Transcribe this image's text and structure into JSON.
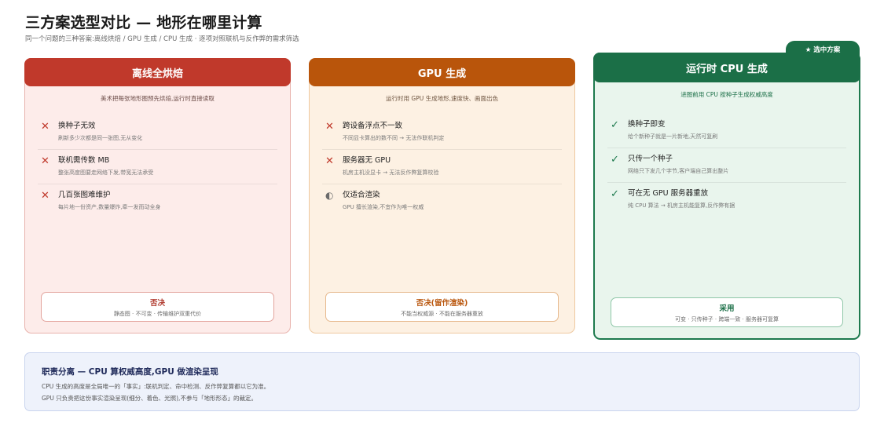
{
  "header": {
    "title": "三方案选型对比 — 地形在哪里计算",
    "subtitle": "同一个问题的三种答案:离线烘焙 / GPU 生成 / CPU 生成 · 逐项对照联机与反作弊的需求筛选"
  },
  "badge": "★ 选中方案",
  "cards": [
    {
      "title": "离线全烘焙",
      "desc": "美术把每张地形图预先烘焙,运行时直接读取",
      "items": [
        {
          "icon": "cross-icon",
          "glyph": "✕",
          "title": "换种子无效",
          "sub": "刷新多少次都是同一张图,无从变化"
        },
        {
          "icon": "cross-icon",
          "glyph": "✕",
          "title": "联机需传数 MB",
          "sub": "整张高度图要走网络下发,带宽无法承受"
        },
        {
          "icon": "cross-icon",
          "glyph": "✕",
          "title": "几百张图难维护",
          "sub": "每片地一份资产,数量爆炸,牵一发而动全身"
        }
      ],
      "verdict": {
        "title": "否决",
        "sub": "静态图 · 不可变 · 传输维护双重代价"
      }
    },
    {
      "title": "GPU 生成",
      "desc": "运行时用 GPU 生成地形,速度快、画面出色",
      "items": [
        {
          "icon": "cross-icon",
          "glyph": "✕",
          "title": "跨设备浮点不一致",
          "sub": "不同显卡算出的数不同 → 无法作联机判定"
        },
        {
          "icon": "cross-icon",
          "glyph": "✕",
          "title": "服务器无 GPU",
          "sub": "机房主机没显卡 → 无法反作弊复算校验"
        },
        {
          "icon": "half-circle-icon",
          "glyph": "◐",
          "title": "仅适合渲染",
          "sub": "GPU 擅长渲染,不宜作为唯一权威"
        }
      ],
      "verdict": {
        "title": "否决(留作渲染)",
        "sub": "不能当权威源 · 不能在服务器重放"
      }
    },
    {
      "title": "运行时 CPU 生成",
      "desc": "进图前用 CPU 按种子生成权威高度",
      "items": [
        {
          "icon": "check-icon",
          "glyph": "✓",
          "title": "换种子即变",
          "sub": "给个新种子就是一片新地,天然可复刷"
        },
        {
          "icon": "check-icon",
          "glyph": "✓",
          "title": "只传一个种子",
          "sub": "网络只下发几个字节,客户端自己算出整片"
        },
        {
          "icon": "check-icon",
          "glyph": "✓",
          "title": "可在无 GPU 服务器重放",
          "sub": "纯 CPU 算法 → 机房主机能复算,反作弊有据"
        }
      ],
      "verdict": {
        "title": "采用",
        "sub": "可变 · 只传种子 · 跨端一致 · 服务器可复算"
      }
    }
  ],
  "note": {
    "title": "职责分离 — CPU 算权威高度,GPU 做渲染呈现",
    "line1": "CPU 生成的高度是全局唯一的「事实」:联机判定、命中检测、反作弊复算都以它为准。",
    "line2": "GPU 只负责把这份事实渲染呈现(细分、着色、光照),不参与「地形形态」的裁定。"
  },
  "colors": {
    "reject_red": "#c0392b",
    "gpu_orange": "#b9550b",
    "adopt_green": "#1b6f47",
    "note_bg": "#eef2fb"
  }
}
